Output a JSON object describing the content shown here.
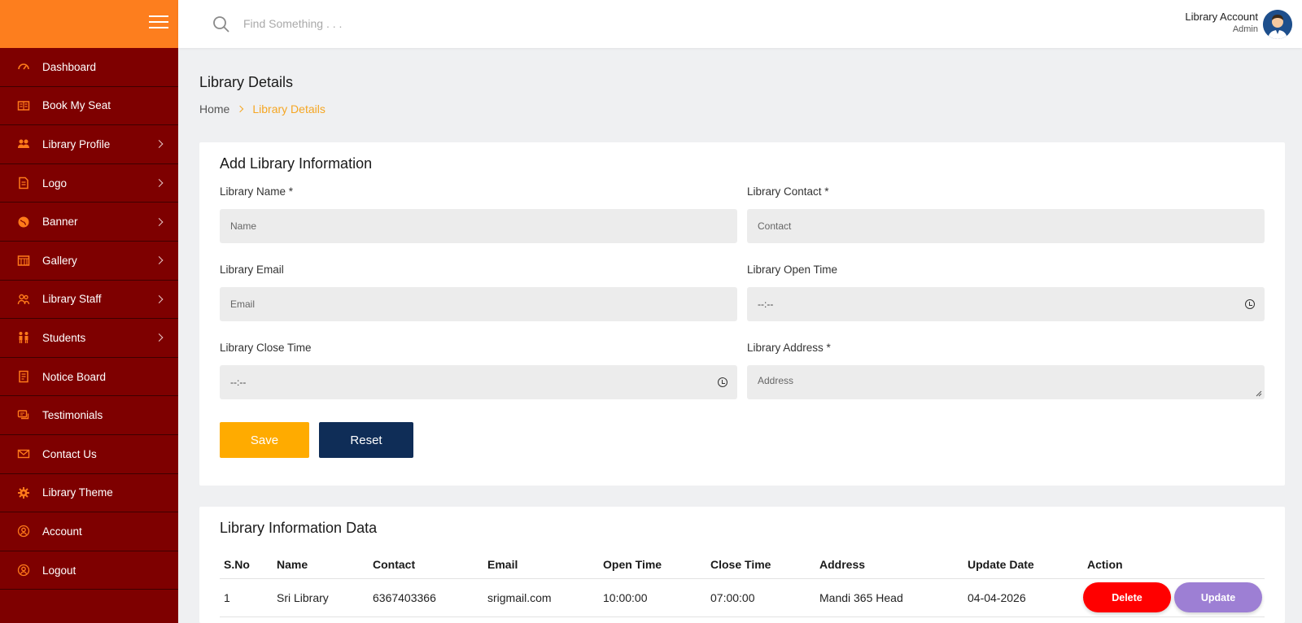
{
  "search": {
    "placeholder": "Find Something . . ."
  },
  "account": {
    "title": "Library Account",
    "role": "Admin"
  },
  "sidebar": {
    "items": [
      {
        "label": "Dashboard",
        "icon": "dashboard-icon",
        "has_chevron": false
      },
      {
        "label": "Book My Seat",
        "icon": "book-icon",
        "has_chevron": false
      },
      {
        "label": "Library Profile",
        "icon": "users-icon",
        "has_chevron": true
      },
      {
        "label": "Logo",
        "icon": "file-icon",
        "has_chevron": true
      },
      {
        "label": "Banner",
        "icon": "globe-icon",
        "has_chevron": true
      },
      {
        "label": "Gallery",
        "icon": "gallery-icon",
        "has_chevron": true
      },
      {
        "label": "Library Staff",
        "icon": "staff-icon",
        "has_chevron": true
      },
      {
        "label": "Students",
        "icon": "students-icon",
        "has_chevron": true
      },
      {
        "label": "Notice Board",
        "icon": "notice-icon",
        "has_chevron": false
      },
      {
        "label": "Testimonials",
        "icon": "chat-icon",
        "has_chevron": false
      },
      {
        "label": "Contact Us",
        "icon": "mail-icon",
        "has_chevron": false
      },
      {
        "label": "Library Theme",
        "icon": "gear-icon",
        "has_chevron": false
      },
      {
        "label": "Account",
        "icon": "account-icon",
        "has_chevron": false
      },
      {
        "label": "Logout",
        "icon": "logout-icon",
        "has_chevron": false
      }
    ]
  },
  "page": {
    "title": "Library Details",
    "breadcrumb": {
      "home": "Home",
      "current": "Library Details"
    }
  },
  "form": {
    "title": "Add Library Information",
    "name_label": "Library Name *",
    "name_placeholder": "Name",
    "contact_label": "Library Contact *",
    "contact_placeholder": "Contact",
    "email_label": "Library Email",
    "email_placeholder": "Email",
    "open_label": "Library Open Time",
    "open_value": "--:--",
    "close_label": "Library Close Time",
    "close_value": "--:--",
    "address_label": "Library Address *",
    "address_placeholder": "Address",
    "save_label": "Save",
    "reset_label": "Reset"
  },
  "table": {
    "title": "Library Information Data",
    "headers": [
      "S.No",
      "Name",
      "Contact",
      "Email",
      "Open Time",
      "Close Time",
      "Address",
      "Update Date",
      "Action"
    ],
    "rows": [
      {
        "sno": "1",
        "name": "Sri Library",
        "contact": "6367403366",
        "email": "srigmail.com",
        "open": "10:00:00",
        "close": "07:00:00",
        "address": "Mandi 365 Head",
        "updated": "04-04-2026"
      }
    ],
    "delete_label": "Delete",
    "update_label": "Update"
  },
  "colors": {
    "sidebar_bg": "#7e0000",
    "sidebar_header": "#fd7e1e",
    "icon_accent": "#ff7a1a",
    "save_button": "#ffab00",
    "reset_button": "#0f2d57",
    "delete_button": "#ff0000",
    "update_button": "#9d7fd4",
    "breadcrumb_active": "#f5a623"
  }
}
